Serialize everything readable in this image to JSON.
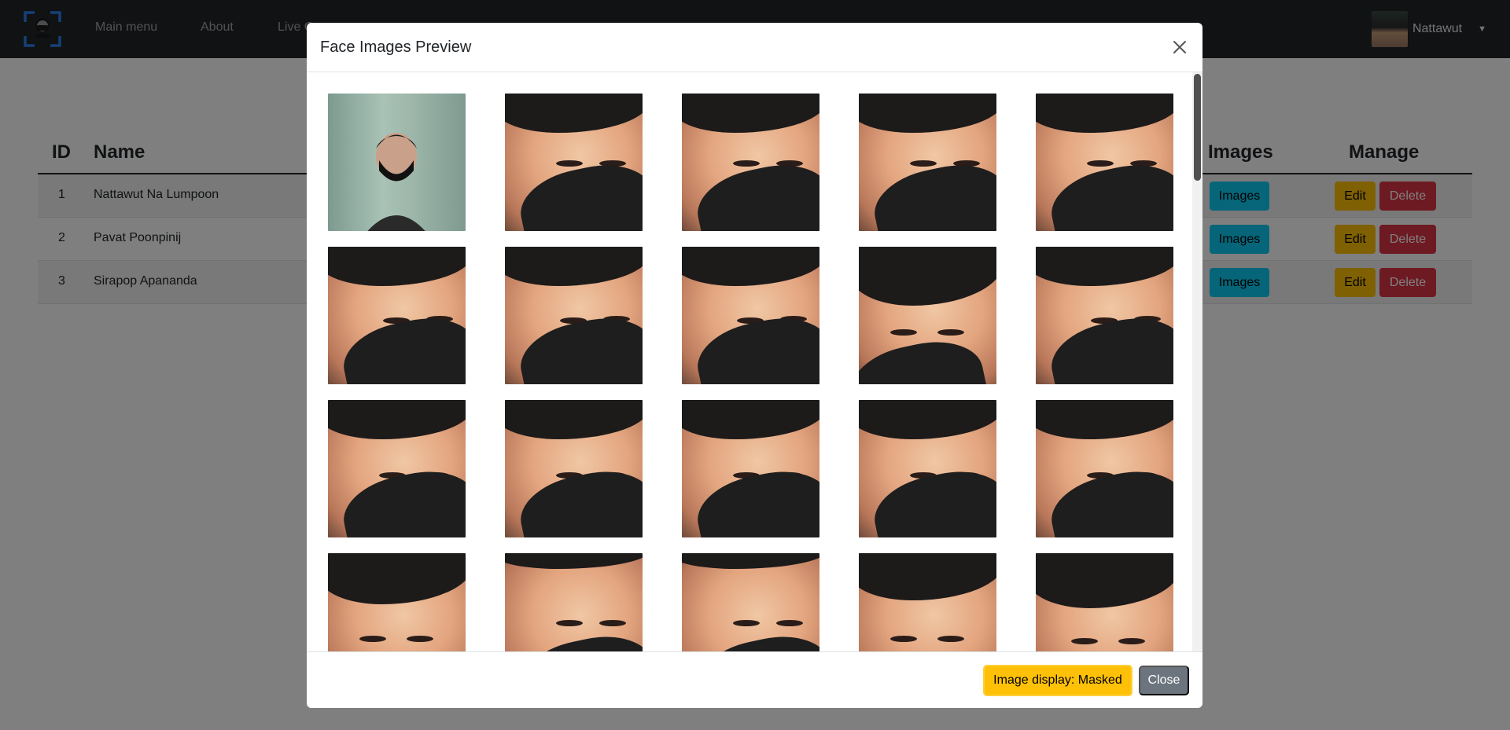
{
  "navbar": {
    "links": [
      "Main menu",
      "About",
      "Live C"
    ],
    "user_name": "Nattawut"
  },
  "table": {
    "headers": [
      "ID",
      "Name",
      "Images",
      "Manage"
    ],
    "rows": [
      {
        "id": "1",
        "name": "Nattawut Na Lumpoon"
      },
      {
        "id": "2",
        "name": "Pavat Poonpinij"
      },
      {
        "id": "3",
        "name": "Sirapop Apananda"
      }
    ],
    "images_label": "Images",
    "edit_label": "Edit",
    "delete_label": "Delete"
  },
  "modal": {
    "title": "Face Images Preview",
    "footer": {
      "display_toggle_label": "Image display: Masked",
      "close_label": "Close"
    }
  },
  "colors": {
    "navbar": "#212529",
    "info": "#0dcaf0",
    "warning": "#ffc107",
    "danger": "#dc3545",
    "secondary": "#6c757d"
  }
}
